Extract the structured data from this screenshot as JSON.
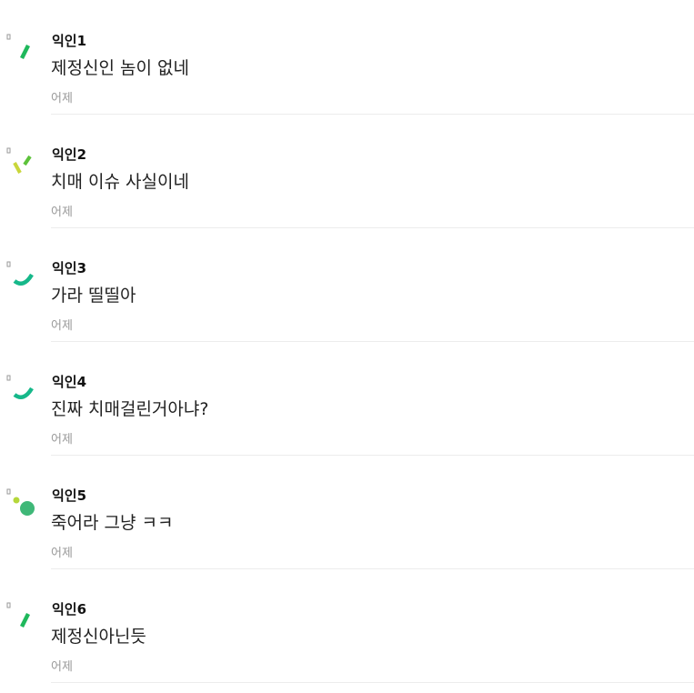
{
  "comments": [
    {
      "author": "익인1",
      "text": "제정신인 놈이 없네",
      "time": "어제",
      "avatar_icon": "green-dash-avatar-icon",
      "avatar_colors": [
        "#1fb85c"
      ]
    },
    {
      "author": "익인2",
      "text": "치매 이슈 사실이네",
      "time": "어제",
      "avatar_icon": "yellow-green-check-avatar-icon",
      "avatar_colors": [
        "#c9d63a",
        "#5cc23a"
      ]
    },
    {
      "author": "익인3",
      "text": "가라 띨띨아",
      "time": "어제",
      "avatar_icon": "teal-smile-avatar-icon",
      "avatar_colors": [
        "#16b88a"
      ]
    },
    {
      "author": "익인4",
      "text": "진짜 치매걸린거아냐?",
      "time": "어제",
      "avatar_icon": "teal-smile-avatar-icon",
      "avatar_colors": [
        "#16b88a"
      ]
    },
    {
      "author": "익인5",
      "text": "죽어라 그냥 ㅋㅋ",
      "time": "어제",
      "avatar_icon": "green-dots-avatar-icon",
      "avatar_colors": [
        "#b5d73a",
        "#3fb878"
      ]
    },
    {
      "author": "익인6",
      "text": "제정신아닌듯",
      "time": "어제",
      "avatar_icon": "green-dash-avatar-icon",
      "avatar_colors": [
        "#1fb85c"
      ]
    }
  ],
  "placeholder_glyph_color": "#9a9a9a"
}
